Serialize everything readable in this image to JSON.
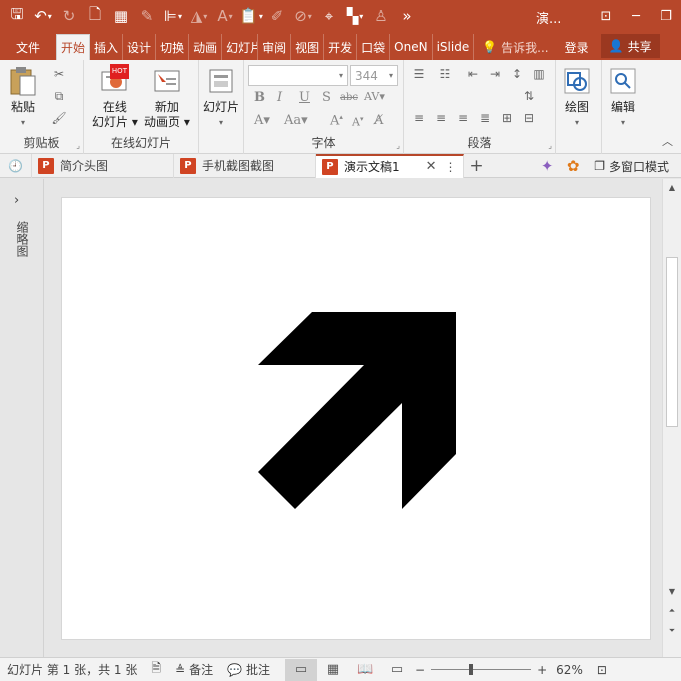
{
  "titlebar": {
    "title": "演...",
    "qat_icons": [
      "save-icon",
      "undo-icon",
      "redo-icon",
      "new-file-icon",
      "layout-icon",
      "eyedropper-icon",
      "align-icon",
      "fill-icon",
      "font-color-icon",
      "paste-icon",
      "format-painter-icon",
      "shape-icon",
      "target-icon",
      "color-icon",
      "person-icon",
      "more-icon"
    ]
  },
  "tabs": [
    {
      "label": "文件"
    },
    {
      "label": "开始"
    },
    {
      "label": "插入"
    },
    {
      "label": "设计"
    },
    {
      "label": "切换"
    },
    {
      "label": "动画"
    },
    {
      "label": "幻灯片"
    },
    {
      "label": "审阅"
    },
    {
      "label": "视图"
    },
    {
      "label": "开发"
    },
    {
      "label": "口袋"
    },
    {
      "label": "OneN"
    },
    {
      "label": "iSlide"
    }
  ],
  "tellme": "告诉我...",
  "login": "登录",
  "share": "共享",
  "ribbon": {
    "clipboard": {
      "paste": "粘贴",
      "label": "剪贴板"
    },
    "online_slides": {
      "btn1_line1": "在线",
      "btn1_line2": "幻灯片",
      "btn2_line1": "新加",
      "btn2_line2": "动画页",
      "hot_badge": "HOT",
      "label": "在线幻灯片"
    },
    "slides": {
      "button": "幻灯片"
    },
    "font": {
      "font_name": "",
      "font_size": "344",
      "label": "字体"
    },
    "paragraph": {
      "label": "段落"
    },
    "drawing": {
      "button": "绘图"
    },
    "editing": {
      "button": "编辑"
    }
  },
  "doctabs": [
    {
      "label": "简介头图",
      "active": false
    },
    {
      "label": "手机截图截图",
      "active": false
    },
    {
      "label": "演示文稿1",
      "active": true
    }
  ],
  "multiwindow": "多窗口模式",
  "thumbnails_label": "缩略图",
  "slide": {
    "arrow_color": "#000000"
  },
  "statusbar": {
    "slide_info": "幻灯片 第 1 张，共 1 张",
    "notes": "备注",
    "comments": "批注",
    "zoom_percent": "62%",
    "zoom_slider_fraction": 0.39
  },
  "colors": {
    "accent": "#b7472a",
    "ribbon": "#f3f3f3",
    "workspace": "#e6e6e6"
  }
}
